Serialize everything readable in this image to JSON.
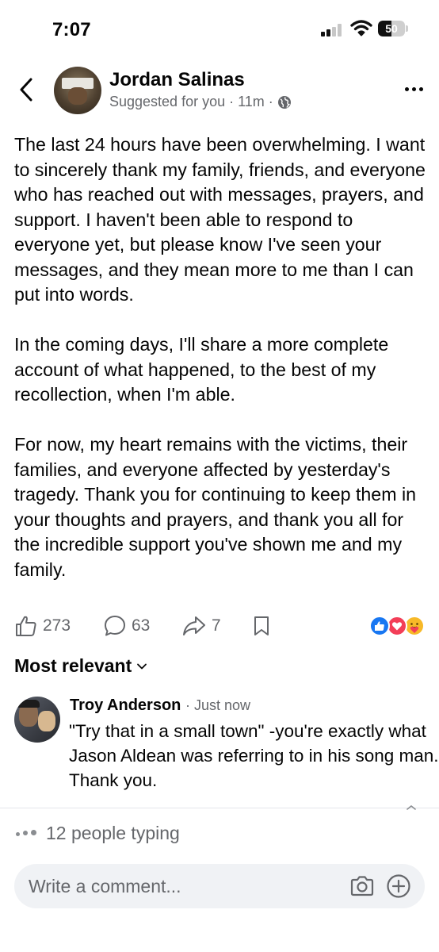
{
  "status_bar": {
    "time": "7:07",
    "battery_level": "50",
    "icons": [
      "signal-icon",
      "wifi-icon",
      "battery-icon"
    ]
  },
  "post": {
    "author": "Jordan Salinas",
    "meta_suggested": "Suggested for you",
    "meta_time": "11m",
    "meta_separator": "·",
    "audience_icon": "globe-icon",
    "paragraphs": [
      "The last 24 hours have been overwhelming. I want to sincerely thank my family, friends, and everyone who has reached out with messages, prayers, and support. I haven't been able to respond to everyone yet, but please know I've seen your messages, and they mean more to me than I can put into words.",
      "In the coming days, I'll share a more complete account of what happened, to the best of my recollection, when I'm able.",
      "For now, my heart remains with the victims, their families, and everyone affected by yesterday's tragedy. Thank you for continuing to keep them in your thoughts and prayers, and thank you all for the incredible support you've shown me and my family."
    ]
  },
  "actions": {
    "likes": "273",
    "comments": "63",
    "shares": "7",
    "reactions": [
      "like-reaction-icon",
      "love-reaction-icon",
      "care-reaction-icon"
    ],
    "colors": {
      "like": "#1877f2",
      "love": "#f33e58",
      "care": "#f7b928"
    }
  },
  "comments_section": {
    "sort_label": "Most relevant",
    "items": [
      {
        "author": "Troy Anderson",
        "time": "· Just now",
        "text": "\"Try that in a small town\" -you're exactly what Jason Aldean was referring to in his song man. Thank you."
      }
    ]
  },
  "composer": {
    "typing_text": "12 people typing",
    "placeholder": "Write a comment..."
  }
}
